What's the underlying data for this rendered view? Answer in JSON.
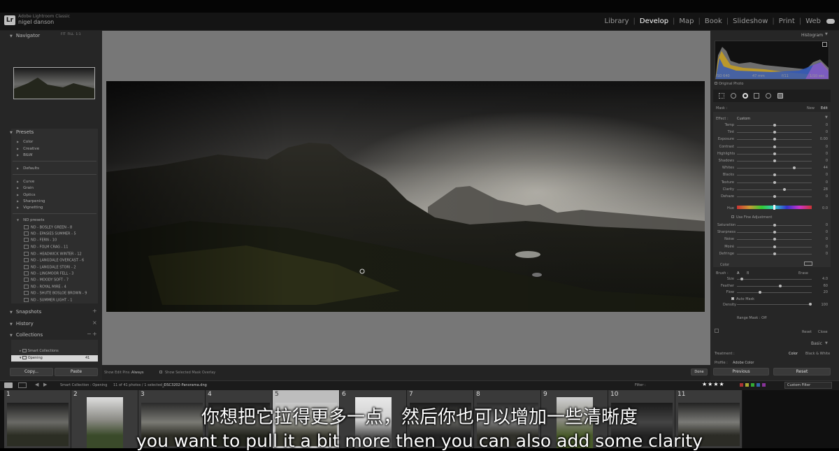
{
  "app": {
    "account": "Adobe Lightroom Classic",
    "user": "nigel danson"
  },
  "modules": [
    "Library",
    "Develop",
    "Map",
    "Book",
    "Slideshow",
    "Print",
    "Web"
  ],
  "active_module": "Develop",
  "left_panel": {
    "navigator": {
      "title": "Navigator",
      "zoom_options": [
        "FIT",
        "FILL",
        "1:1"
      ]
    },
    "presets": {
      "title": "Presets",
      "groups": [
        "Color",
        "Creative",
        "B&W"
      ],
      "groups2": [
        "Defaults"
      ],
      "groups3": [
        "Curve",
        "Grain",
        "Optics",
        "Sharpening",
        "Vignetting"
      ],
      "nd_group": "ND presets",
      "nd_items": [
        "ND - BOSLEY GREEN - 8",
        "ND - EPASIES SUMMER - 5",
        "ND - FERN - 10",
        "ND - FOLM CRAG - 11",
        "ND - HEADWICK WINTER - 12",
        "ND - LANGDALE OVERCAST - 6",
        "ND - LANGDALE STORI - 2",
        "ND - LINGMOOR FELL - 3",
        "ND - MOODY SOFT - 7",
        "ND - ROYAL MIRE - 4",
        "ND - SHUTE BOSLOE BROWN - 9",
        "ND - SUMMER LIGHT - 1"
      ]
    },
    "snapshots": "Snapshots",
    "history": "History",
    "collections": {
      "title": "Collections",
      "items": [
        "Smart Collections",
        "Opening"
      ],
      "count": "41"
    },
    "copy_label": "Copy...",
    "paste_label": "Paste"
  },
  "toolbar": {
    "show_edit_pins": "Show Edit Pins :",
    "pins_value": "Always",
    "show_overlay": "Show Selected Mask Overlay",
    "done": "Done"
  },
  "right_panel": {
    "histogram": "Histogram",
    "hist_info": [
      "ISO 640",
      "47 mm",
      "f/11",
      "1/10 sec"
    ],
    "original_photo": "Original Photo",
    "mask_label": "Mask :",
    "mask_new": "New",
    "mask_edit": "Edit",
    "effect_label": "Effect :",
    "effect_value": "Custom",
    "sliders": [
      {
        "label": "Temp",
        "value": "0",
        "pos": 0.5
      },
      {
        "label": "Tint",
        "value": "0",
        "pos": 0.5
      },
      {
        "label": "Exposure",
        "value": "0.00",
        "pos": 0.5
      },
      {
        "label": "Contrast",
        "value": "0",
        "pos": 0.5
      },
      {
        "label": "Highlights",
        "value": "0",
        "pos": 0.5
      },
      {
        "label": "Shadows",
        "value": "0",
        "pos": 0.5
      },
      {
        "label": "Whites",
        "value": "44",
        "pos": 0.78
      },
      {
        "label": "Blacks",
        "value": "0",
        "pos": 0.5
      },
      {
        "label": "Texture",
        "value": "0",
        "pos": 0.5
      },
      {
        "label": "Clarity",
        "value": "28",
        "pos": 0.64
      },
      {
        "label": "Dehaze",
        "value": "0",
        "pos": 0.5
      }
    ],
    "hue_label": "Hue",
    "hue_value": "0.0",
    "fine_adjust": "Use Fine Adjustment",
    "sliders2": [
      {
        "label": "Saturation",
        "value": "0",
        "pos": 0.5
      },
      {
        "label": "Sharpness",
        "value": "0",
        "pos": 0.5
      },
      {
        "label": "Noise",
        "value": "0",
        "pos": 0.5
      },
      {
        "label": "Moiré",
        "value": "0",
        "pos": 0.5
      },
      {
        "label": "Defringe",
        "value": "0",
        "pos": 0.5
      }
    ],
    "color_label": "Color",
    "brush_label": "Brush :",
    "brush_a": "A",
    "brush_b": "B",
    "brush_erase": "Erase",
    "brush_sliders": [
      {
        "label": "Size",
        "value": "4.0",
        "pos": 0.05
      },
      {
        "label": "Feather",
        "value": "60",
        "pos": 0.58
      },
      {
        "label": "Flow",
        "value": "20",
        "pos": 0.3
      }
    ],
    "auto_mask": "Auto Mask",
    "density_label": "Density",
    "density_value": "100",
    "range_mask": "Range Mask : Off",
    "reset": "Reset",
    "close": "Close",
    "basic": "Basic",
    "treatment_label": "Treatment :",
    "treatment_color": "Color",
    "treatment_bw": "Black & White",
    "profile_label": "Profile :",
    "profile_value": "Adobe Color",
    "previous": "Previous",
    "reset2": "Reset"
  },
  "filmstrip": {
    "source": "Smart Collection : Opening",
    "count": "11 of 41 photos / 1 selected /",
    "filename": "_DSC3202-Panorama.dng",
    "filter_label": "Filter :",
    "custom_filter": "Custom Filter",
    "stars": "★★★★",
    "numbers": [
      "1",
      "2",
      "3",
      "4",
      "5",
      "6",
      "7",
      "8",
      "9",
      "10",
      "11"
    ],
    "selected": 4
  },
  "subtitles": {
    "zh": "你想把它拉得更多一点，然后你也可以增加一些清晰度",
    "en": "you want to pull it a bit more then you can also add some clarity"
  },
  "colors": {
    "panel": "#262626",
    "canvas": "#777777",
    "active_module": "#ffffff"
  }
}
